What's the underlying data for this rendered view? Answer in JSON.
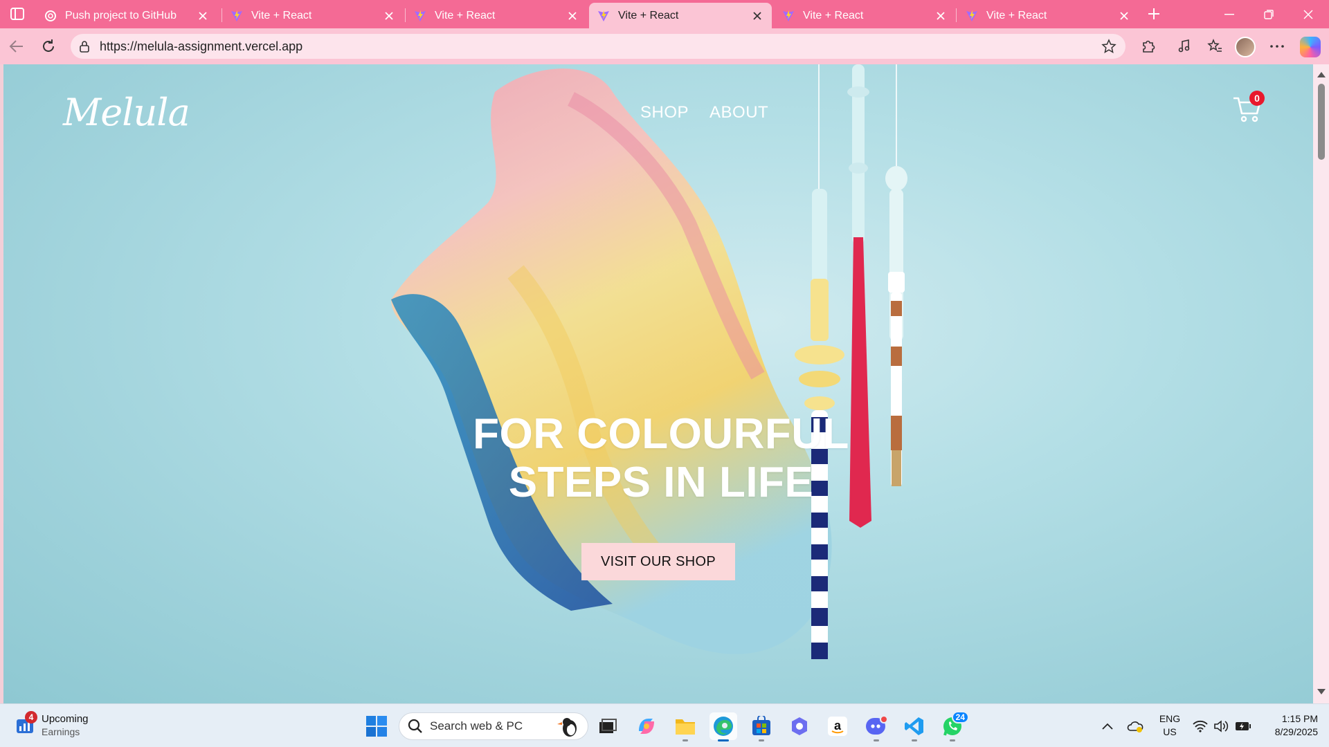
{
  "browser": {
    "tabs": [
      {
        "title": "Push project to GitHub",
        "icon": "openai-icon",
        "active": false
      },
      {
        "title": "Vite + React",
        "icon": "vite-icon",
        "active": false
      },
      {
        "title": "Vite + React",
        "icon": "vite-icon",
        "active": false
      },
      {
        "title": "Vite + React",
        "icon": "vite-icon",
        "active": true
      },
      {
        "title": "Vite + React",
        "icon": "vite-icon",
        "active": false
      },
      {
        "title": "Vite + React",
        "icon": "vite-icon",
        "active": false
      }
    ],
    "address": {
      "url": "https://melula-assignment.vercel.app"
    },
    "colors": {
      "tabstrip": "#f46a95",
      "toolbar": "#fbc5d5",
      "omnibox": "#fde4ec"
    }
  },
  "site": {
    "logo": "Melula",
    "nav": {
      "shop": "SHOP",
      "about": "ABOUT"
    },
    "cart_count": "0",
    "hero": {
      "title_line1": "FOR COLOURFUL",
      "title_line2": "STEPS IN LIFE",
      "cta": "VISIT OUR SHOP"
    },
    "colors": {
      "background": "#a8d8df",
      "cta": "#fbd8da",
      "badge": "#e8182c"
    }
  },
  "taskbar": {
    "widget": {
      "badge": "4",
      "title": "Upcoming",
      "subtitle": "Earnings"
    },
    "search_placeholder": "Search web & PC",
    "apps": [
      {
        "name": "task-view-icon"
      },
      {
        "name": "copilot-app-icon"
      },
      {
        "name": "file-explorer-icon"
      },
      {
        "name": "edge-icon",
        "active": true
      },
      {
        "name": "microsoft-store-icon"
      },
      {
        "name": "app-icon"
      },
      {
        "name": "amazon-icon"
      },
      {
        "name": "discord-icon"
      },
      {
        "name": "vscode-icon"
      },
      {
        "name": "whatsapp-icon",
        "badge": "24"
      }
    ],
    "language": {
      "line1": "ENG",
      "line2": "US"
    },
    "clock": {
      "time": "1:15 PM",
      "date": "8/29/2025"
    }
  }
}
